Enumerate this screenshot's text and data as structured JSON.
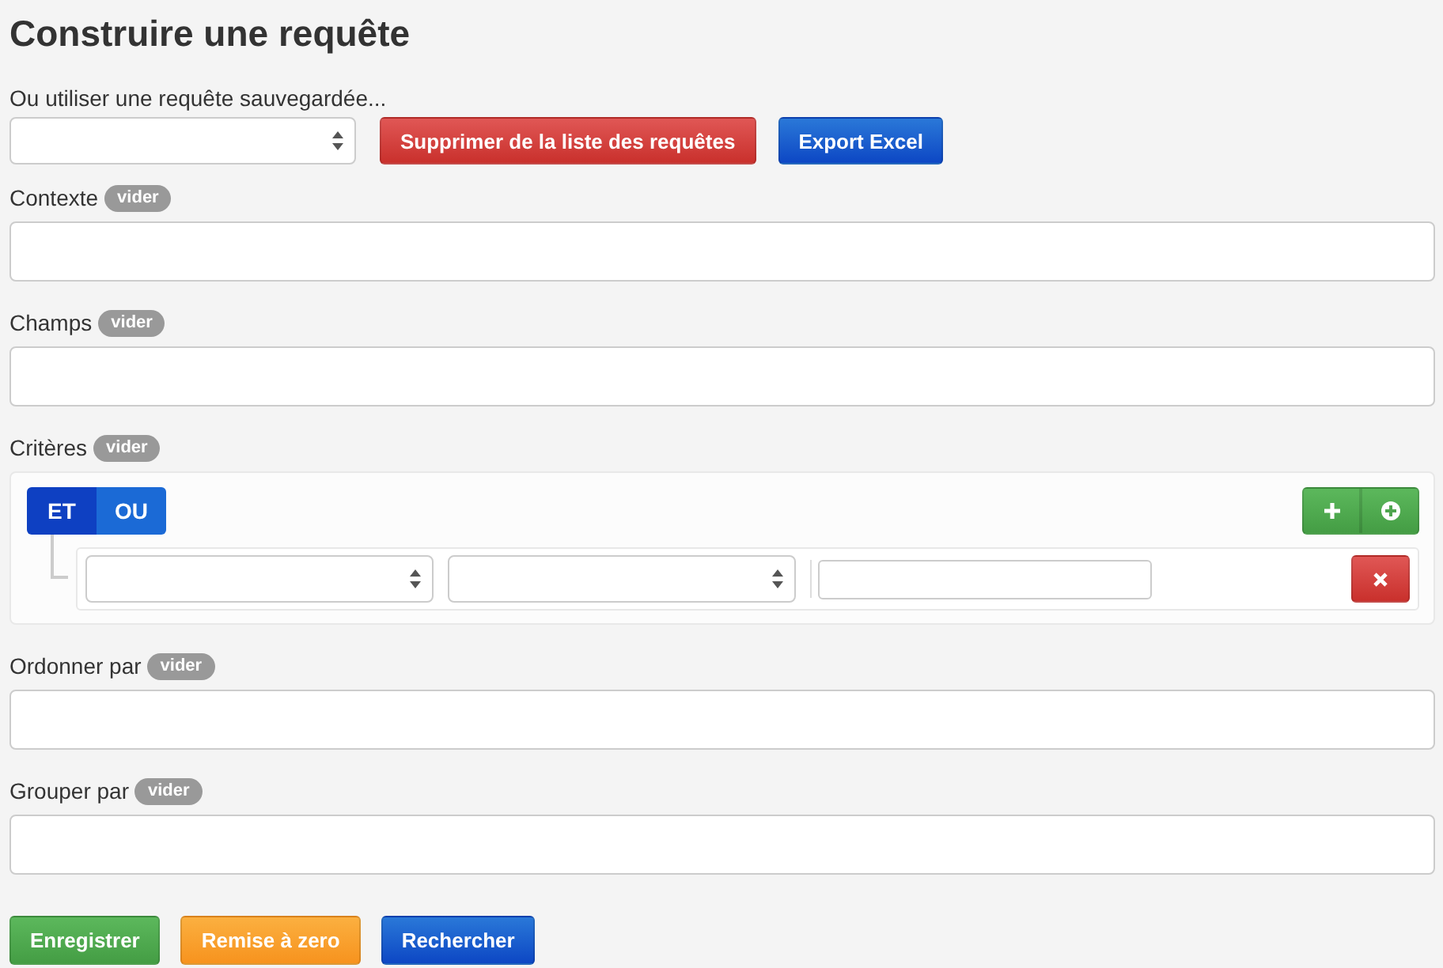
{
  "title": "Construire une requête",
  "saved_query": {
    "label": "Ou utiliser une requête sauvegardée...",
    "buttons": [
      {
        "label": "Supprimer de la liste des requêtes",
        "kind": "danger"
      },
      {
        "label": "Export Excel",
        "kind": "primary"
      }
    ]
  },
  "sections": [
    {
      "kind": "field",
      "label": "Contexte",
      "badge": "vider"
    },
    {
      "kind": "field",
      "label": "Champs",
      "badge": "vider"
    },
    {
      "kind": "criteria",
      "label": "Critères",
      "badge": "vider",
      "conjunctions": [
        {
          "label": "ET",
          "selected": true
        },
        {
          "label": "OU",
          "selected": false
        }
      ],
      "rules": [
        {
          "kind": "rule"
        }
      ]
    },
    {
      "kind": "field",
      "label": "Ordonner par",
      "badge": "vider"
    },
    {
      "kind": "field",
      "label": "Grouper par",
      "badge": "vider"
    }
  ],
  "actions": [
    {
      "label": "Enregistrer",
      "kind": "success"
    },
    {
      "label": "Remise à zero",
      "kind": "warning"
    },
    {
      "label": "Rechercher",
      "kind": "primary"
    }
  ]
}
